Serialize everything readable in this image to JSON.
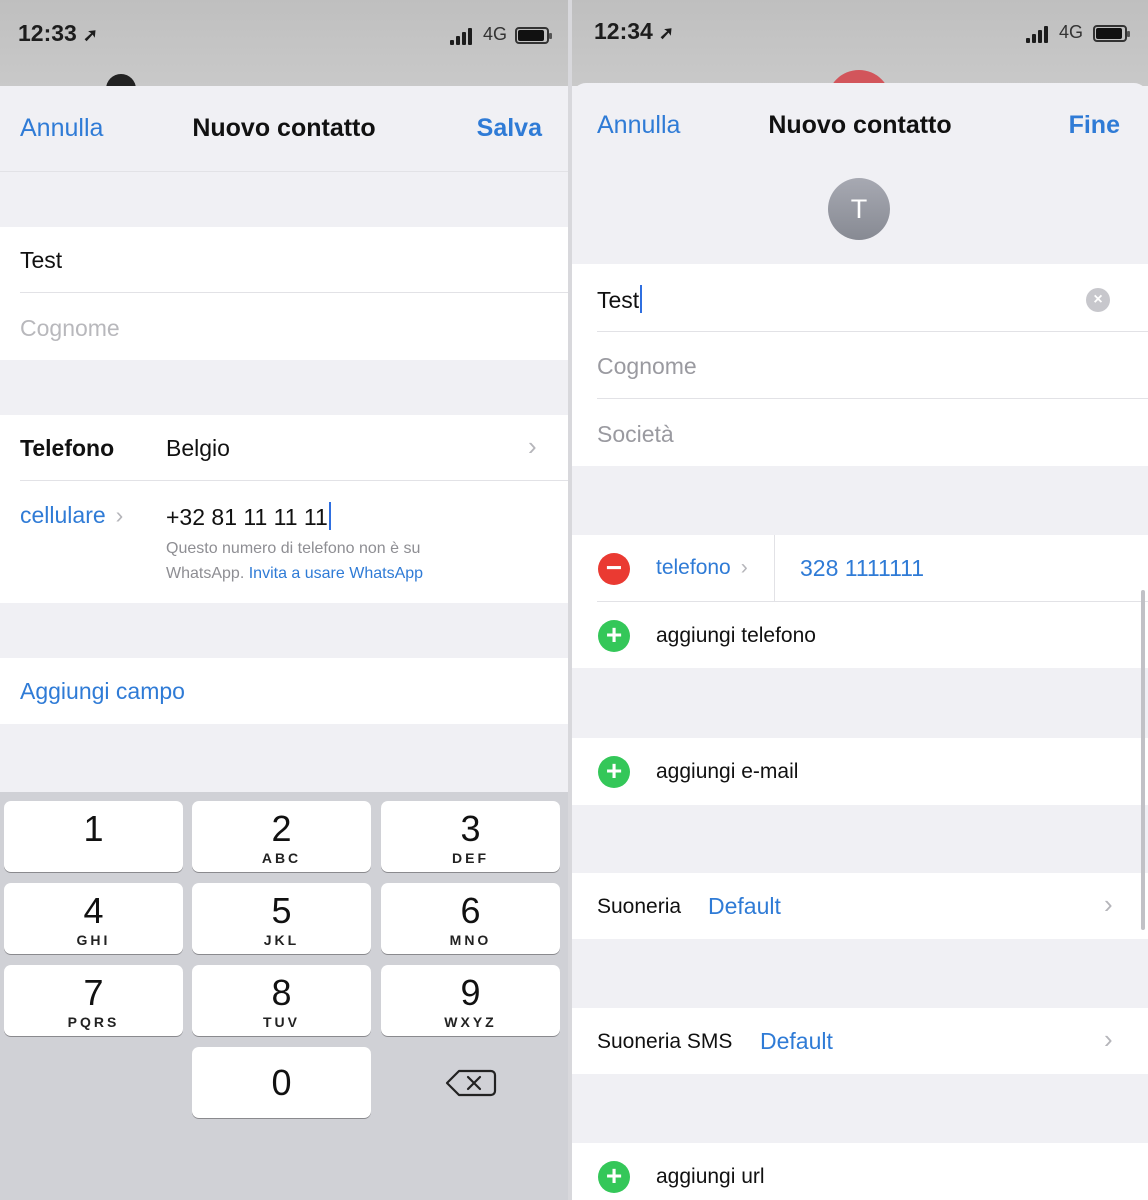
{
  "left": {
    "status": {
      "time": "12:33",
      "network": "4G"
    },
    "nav": {
      "cancel": "Annulla",
      "title": "Nuovo contatto",
      "save": "Salva"
    },
    "name_value": "Test",
    "surname_placeholder": "Cognome",
    "phone_label": "Telefono",
    "country": "Belgio",
    "phone_type": "cellulare",
    "phone_number": "+32  81 11 11 11",
    "whatsapp_note": "Questo numero di telefono non è su",
    "whatsapp_note2": "WhatsApp.",
    "whatsapp_link": "Invita a usare WhatsApp",
    "add_field": "Aggiungi campo",
    "keypad": [
      {
        "num": "1",
        "letters": ""
      },
      {
        "num": "2",
        "letters": "ABC"
      },
      {
        "num": "3",
        "letters": "DEF"
      },
      {
        "num": "4",
        "letters": "GHI"
      },
      {
        "num": "5",
        "letters": "JKL"
      },
      {
        "num": "6",
        "letters": "MNO"
      },
      {
        "num": "7",
        "letters": "PQRS"
      },
      {
        "num": "8",
        "letters": "TUV"
      },
      {
        "num": "9",
        "letters": "WXYZ"
      },
      {
        "num": "0",
        "letters": ""
      }
    ]
  },
  "right": {
    "status": {
      "time": "12:34",
      "network": "4G"
    },
    "nav": {
      "cancel": "Annulla",
      "title": "Nuovo contatto",
      "done": "Fine"
    },
    "avatar_initial": "T",
    "name_value": "Test",
    "surname_placeholder": "Cognome",
    "company_placeholder": "Società",
    "phone_type": "telefono",
    "phone_number": "328 1111111",
    "add_phone": "aggiungi telefono",
    "add_email": "aggiungi e-mail",
    "ringtone_label": "Suoneria",
    "ringtone_value": "Default",
    "sms_label": "Suoneria SMS",
    "sms_value": "Default",
    "add_url": "aggiungi url"
  },
  "colors": {
    "accent": "#2f7bd6",
    "delete": "#ea3a32",
    "add": "#34c759"
  }
}
